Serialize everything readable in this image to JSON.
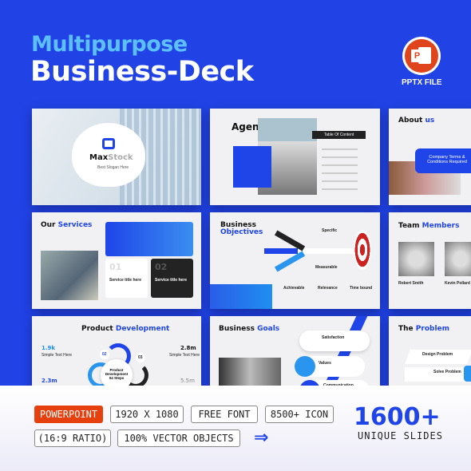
{
  "header": {
    "title_line1": "Multipurpose",
    "title_line2": "Business-Deck",
    "file_badge": "PPTX FILE",
    "file_icon": "powerpoint-icon",
    "file_icon_letter": "P"
  },
  "slides": {
    "cover": {
      "brand_a": "Max",
      "brand_b": "Stock",
      "slogan": "Best Slogan Here"
    },
    "agenda": {
      "title": "Agenda",
      "toc": "Table Of Content"
    },
    "about": {
      "title_a": "About",
      "title_b": "us",
      "box": "Company Terms & Conditions Required"
    },
    "services": {
      "title_a": "Our",
      "title_b": "Services",
      "n1": "01",
      "n2": "02",
      "s1": "Service title here",
      "s2": "Service title here"
    },
    "objectives": {
      "title_a": "Business",
      "title_b": "Objectives",
      "labels": [
        "Specific",
        "Measurable",
        "Achievable",
        "Relevance",
        "Time bound"
      ]
    },
    "team": {
      "title_a": "Team",
      "title_b": "Members",
      "m1": "Robert Smith",
      "m2": "Kevin Pollard"
    },
    "product": {
      "title_a": "Product",
      "title_b": "Development",
      "v1": "1.9k",
      "v2": "2.8m",
      "v3": "2.3m",
      "v4": "5.5m",
      "l1": "Simple Text Here",
      "l2": "Simple Text Here",
      "center": "Product Development 04 Steps",
      "s1": "02",
      "s2": "03"
    },
    "goals": {
      "title_a": "Business",
      "title_b": "Goals",
      "items": [
        "Satisfaction",
        "Values",
        "Communication"
      ]
    },
    "problem": {
      "title_a": "The",
      "title_b": "Problem",
      "items": [
        "Design Problem",
        "Solve Problem"
      ]
    }
  },
  "features": {
    "tags": [
      "POWERPOINT",
      "1920 X 1080",
      "FREE FONT",
      "8500+ ICON",
      "(16:9 RATIO)",
      "100% VECTOR OBJECTS"
    ],
    "count": "1600+",
    "count_label": "UNIQUE SLIDES",
    "arrow_icon": "double-arrow-right-icon"
  },
  "colors": {
    "background": "#2143e6",
    "accent": "#1f45e8",
    "title_light": "#5cc0ff",
    "tag_red": "#e5400e"
  }
}
